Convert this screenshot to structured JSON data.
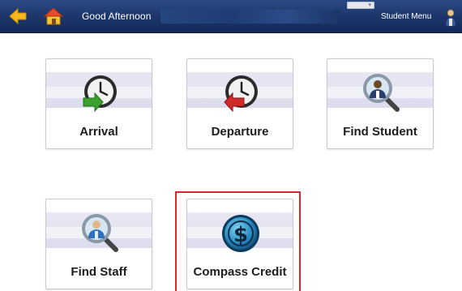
{
  "header": {
    "greeting": "Good Afternoon",
    "menu_label": "Student Menu",
    "back_icon": "back-arrow-icon",
    "home_icon": "home-icon",
    "user_icon": "user-icon"
  },
  "tiles": [
    {
      "label": "Arrival",
      "icon": "clock-arrival-icon"
    },
    {
      "label": "Departure",
      "icon": "clock-departure-icon"
    },
    {
      "label": "Find Student",
      "icon": "search-student-icon"
    },
    {
      "label": "Find Staff",
      "icon": "search-staff-icon"
    },
    {
      "label": "Compass Credit",
      "icon": "dollar-coin-icon"
    }
  ],
  "colors": {
    "header_bg": "#1c3568",
    "highlight": "#e2222e",
    "arrival_arrow": "#3aa02e",
    "departure_arrow": "#d02a2a",
    "credit_coin": "#2a8fc4"
  }
}
